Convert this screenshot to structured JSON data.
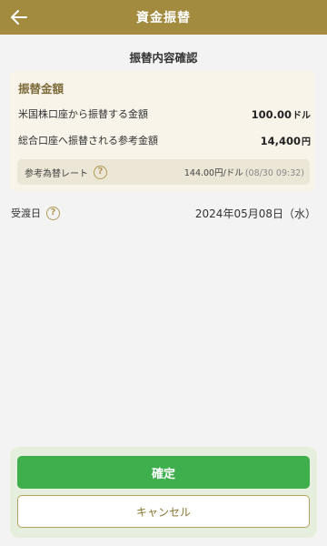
{
  "header": {
    "title": "資金振替",
    "back_icon": "arrow-left-icon"
  },
  "section_title": "振替内容確認",
  "card": {
    "heading": "振替金額",
    "rows": [
      {
        "label": "米国株口座から振替する金額",
        "value": "100.00",
        "unit": "ドル"
      },
      {
        "label": "総合口座へ振替される参考金額",
        "value": "14,400",
        "unit": "円"
      }
    ],
    "rate": {
      "label": "参考為替レート",
      "value": "144.00",
      "unit": "円/ドル",
      "timestamp": "(08/30 09:32)"
    }
  },
  "settlement": {
    "label": "受渡日",
    "date": "2024年05月08日（水）"
  },
  "buttons": {
    "confirm": "確定",
    "cancel": "キャンセル"
  },
  "colors": {
    "header": "#a28a3f",
    "accent_gold": "#b09a56",
    "confirm_green": "#3fae4d",
    "background": "#f3f3f3"
  }
}
